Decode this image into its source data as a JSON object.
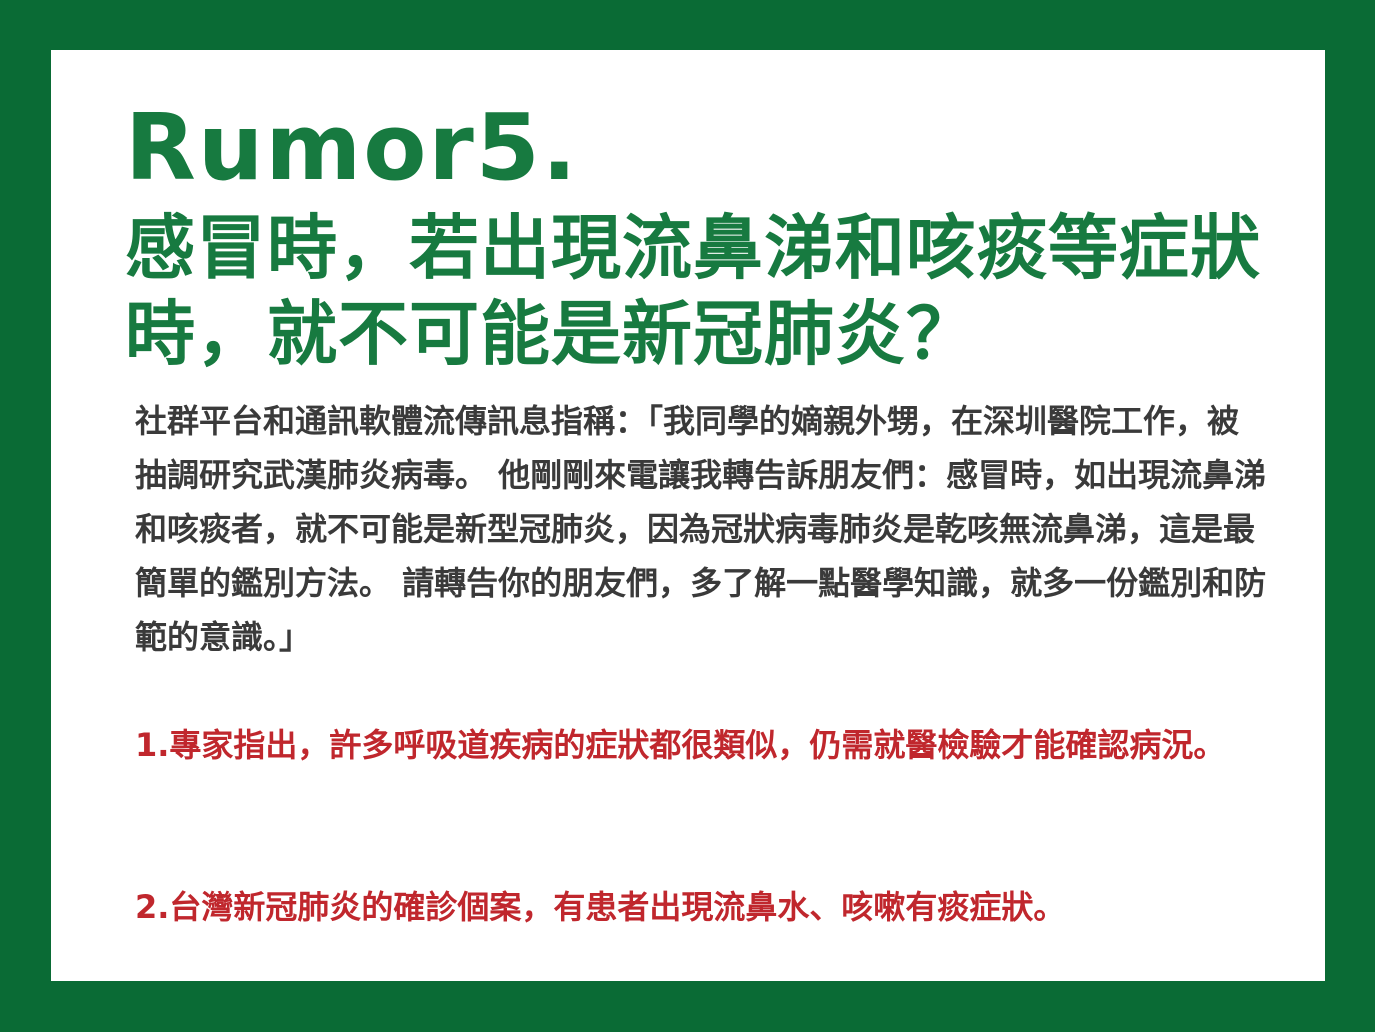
{
  "title": {
    "rumor_label": "Rumor5.",
    "question": "感冒時，若出現流鼻涕和咳痰等症狀時，就不可能是新冠肺炎？"
  },
  "rumor_text": "社群平台和通訊軟體流傳訊息指稱：「我同學的嫡親外甥，在深圳醫院工作，被抽調研究武漢肺炎病毒。 他剛剛來電讓我轉告訴朋友們：感冒時，如出現流鼻涕和咳痰者，就不可能是新型冠肺炎，因為冠狀病毒肺炎是乾咳無流鼻涕，這是最簡單的鑑別方法。 請轉告你的朋友們，多了解一點醫學知識，就多一份鑑別和防範的意識。」",
  "facts": [
    "1.專家指出，許多呼吸道疾病的症狀都很類似，仍需就醫檢驗才能確認病況。",
    "2.台灣新冠肺炎的確診個案，有患者出現流鼻水、咳嗽有痰症狀。"
  ],
  "colors": {
    "frame": "#0a6b35",
    "title": "#177a40",
    "body": "#3a3a3a",
    "fact": "#c0272d"
  }
}
